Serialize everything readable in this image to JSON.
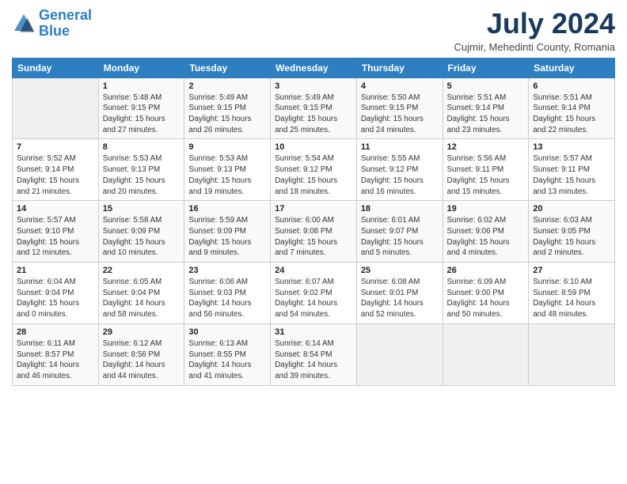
{
  "logo": {
    "line1": "General",
    "line2": "Blue"
  },
  "title": "July 2024",
  "subtitle": "Cujmir, Mehedinti County, Romania",
  "days_header": [
    "Sunday",
    "Monday",
    "Tuesday",
    "Wednesday",
    "Thursday",
    "Friday",
    "Saturday"
  ],
  "weeks": [
    [
      {
        "day": "",
        "sunrise": "",
        "sunset": "",
        "daylight": ""
      },
      {
        "day": "1",
        "sunrise": "Sunrise: 5:48 AM",
        "sunset": "Sunset: 9:15 PM",
        "daylight": "Daylight: 15 hours and 27 minutes."
      },
      {
        "day": "2",
        "sunrise": "Sunrise: 5:49 AM",
        "sunset": "Sunset: 9:15 PM",
        "daylight": "Daylight: 15 hours and 26 minutes."
      },
      {
        "day": "3",
        "sunrise": "Sunrise: 5:49 AM",
        "sunset": "Sunset: 9:15 PM",
        "daylight": "Daylight: 15 hours and 25 minutes."
      },
      {
        "day": "4",
        "sunrise": "Sunrise: 5:50 AM",
        "sunset": "Sunset: 9:15 PM",
        "daylight": "Daylight: 15 hours and 24 minutes."
      },
      {
        "day": "5",
        "sunrise": "Sunrise: 5:51 AM",
        "sunset": "Sunset: 9:14 PM",
        "daylight": "Daylight: 15 hours and 23 minutes."
      },
      {
        "day": "6",
        "sunrise": "Sunrise: 5:51 AM",
        "sunset": "Sunset: 9:14 PM",
        "daylight": "Daylight: 15 hours and 22 minutes."
      }
    ],
    [
      {
        "day": "7",
        "sunrise": "Sunrise: 5:52 AM",
        "sunset": "Sunset: 9:14 PM",
        "daylight": "Daylight: 15 hours and 21 minutes."
      },
      {
        "day": "8",
        "sunrise": "Sunrise: 5:53 AM",
        "sunset": "Sunset: 9:13 PM",
        "daylight": "Daylight: 15 hours and 20 minutes."
      },
      {
        "day": "9",
        "sunrise": "Sunrise: 5:53 AM",
        "sunset": "Sunset: 9:13 PM",
        "daylight": "Daylight: 15 hours and 19 minutes."
      },
      {
        "day": "10",
        "sunrise": "Sunrise: 5:54 AM",
        "sunset": "Sunset: 9:12 PM",
        "daylight": "Daylight: 15 hours and 18 minutes."
      },
      {
        "day": "11",
        "sunrise": "Sunrise: 5:55 AM",
        "sunset": "Sunset: 9:12 PM",
        "daylight": "Daylight: 15 hours and 16 minutes."
      },
      {
        "day": "12",
        "sunrise": "Sunrise: 5:56 AM",
        "sunset": "Sunset: 9:11 PM",
        "daylight": "Daylight: 15 hours and 15 minutes."
      },
      {
        "day": "13",
        "sunrise": "Sunrise: 5:57 AM",
        "sunset": "Sunset: 9:11 PM",
        "daylight": "Daylight: 15 hours and 13 minutes."
      }
    ],
    [
      {
        "day": "14",
        "sunrise": "Sunrise: 5:57 AM",
        "sunset": "Sunset: 9:10 PM",
        "daylight": "Daylight: 15 hours and 12 minutes."
      },
      {
        "day": "15",
        "sunrise": "Sunrise: 5:58 AM",
        "sunset": "Sunset: 9:09 PM",
        "daylight": "Daylight: 15 hours and 10 minutes."
      },
      {
        "day": "16",
        "sunrise": "Sunrise: 5:59 AM",
        "sunset": "Sunset: 9:09 PM",
        "daylight": "Daylight: 15 hours and 9 minutes."
      },
      {
        "day": "17",
        "sunrise": "Sunrise: 6:00 AM",
        "sunset": "Sunset: 9:08 PM",
        "daylight": "Daylight: 15 hours and 7 minutes."
      },
      {
        "day": "18",
        "sunrise": "Sunrise: 6:01 AM",
        "sunset": "Sunset: 9:07 PM",
        "daylight": "Daylight: 15 hours and 5 minutes."
      },
      {
        "day": "19",
        "sunrise": "Sunrise: 6:02 AM",
        "sunset": "Sunset: 9:06 PM",
        "daylight": "Daylight: 15 hours and 4 minutes."
      },
      {
        "day": "20",
        "sunrise": "Sunrise: 6:03 AM",
        "sunset": "Sunset: 9:05 PM",
        "daylight": "Daylight: 15 hours and 2 minutes."
      }
    ],
    [
      {
        "day": "21",
        "sunrise": "Sunrise: 6:04 AM",
        "sunset": "Sunset: 9:04 PM",
        "daylight": "Daylight: 15 hours and 0 minutes."
      },
      {
        "day": "22",
        "sunrise": "Sunrise: 6:05 AM",
        "sunset": "Sunset: 9:04 PM",
        "daylight": "Daylight: 14 hours and 58 minutes."
      },
      {
        "day": "23",
        "sunrise": "Sunrise: 6:06 AM",
        "sunset": "Sunset: 9:03 PM",
        "daylight": "Daylight: 14 hours and 56 minutes."
      },
      {
        "day": "24",
        "sunrise": "Sunrise: 6:07 AM",
        "sunset": "Sunset: 9:02 PM",
        "daylight": "Daylight: 14 hours and 54 minutes."
      },
      {
        "day": "25",
        "sunrise": "Sunrise: 6:08 AM",
        "sunset": "Sunset: 9:01 PM",
        "daylight": "Daylight: 14 hours and 52 minutes."
      },
      {
        "day": "26",
        "sunrise": "Sunrise: 6:09 AM",
        "sunset": "Sunset: 9:00 PM",
        "daylight": "Daylight: 14 hours and 50 minutes."
      },
      {
        "day": "27",
        "sunrise": "Sunrise: 6:10 AM",
        "sunset": "Sunset: 8:59 PM",
        "daylight": "Daylight: 14 hours and 48 minutes."
      }
    ],
    [
      {
        "day": "28",
        "sunrise": "Sunrise: 6:11 AM",
        "sunset": "Sunset: 8:57 PM",
        "daylight": "Daylight: 14 hours and 46 minutes."
      },
      {
        "day": "29",
        "sunrise": "Sunrise: 6:12 AM",
        "sunset": "Sunset: 8:56 PM",
        "daylight": "Daylight: 14 hours and 44 minutes."
      },
      {
        "day": "30",
        "sunrise": "Sunrise: 6:13 AM",
        "sunset": "Sunset: 8:55 PM",
        "daylight": "Daylight: 14 hours and 41 minutes."
      },
      {
        "day": "31",
        "sunrise": "Sunrise: 6:14 AM",
        "sunset": "Sunset: 8:54 PM",
        "daylight": "Daylight: 14 hours and 39 minutes."
      },
      {
        "day": "",
        "sunrise": "",
        "sunset": "",
        "daylight": ""
      },
      {
        "day": "",
        "sunrise": "",
        "sunset": "",
        "daylight": ""
      },
      {
        "day": "",
        "sunrise": "",
        "sunset": "",
        "daylight": ""
      }
    ]
  ]
}
